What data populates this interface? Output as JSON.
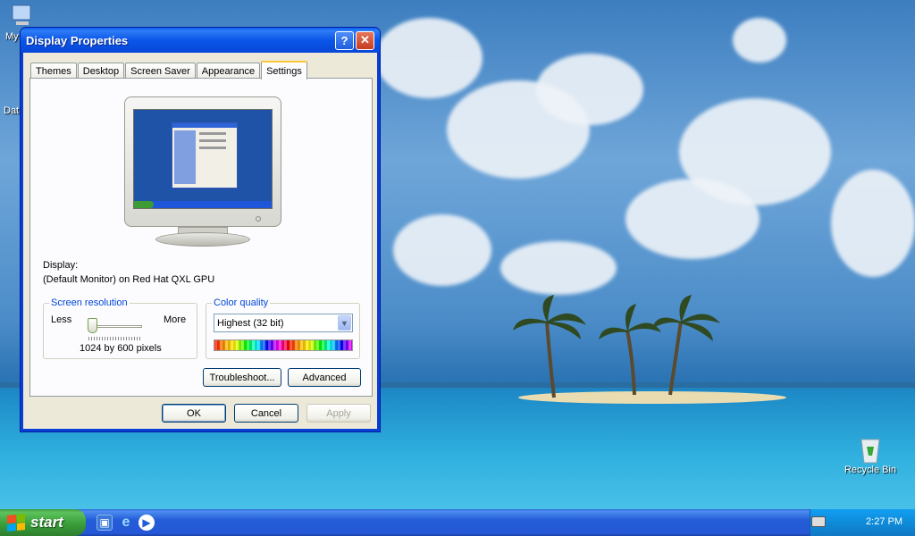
{
  "desktop": {
    "icons": [
      {
        "label": "My"
      },
      {
        "label": "Dat"
      },
      {
        "label": "Recycle Bin"
      }
    ]
  },
  "dialog": {
    "title": "Display Properties",
    "help_button": "?",
    "close_button": "✕",
    "tabs": [
      {
        "label": "Themes"
      },
      {
        "label": "Desktop"
      },
      {
        "label": "Screen Saver"
      },
      {
        "label": "Appearance"
      },
      {
        "label": "Settings",
        "active": true
      }
    ],
    "display_label": "Display:",
    "display_value": "(Default Monitor) on Red Hat QXL GPU",
    "screen_resolution": {
      "legend": "Screen resolution",
      "less_label": "Less",
      "more_label": "More",
      "value_text": "1024 by 600 pixels",
      "slider_level": 0.0
    },
    "color_quality": {
      "legend": "Color quality",
      "selected": "Highest (32 bit)"
    },
    "buttons": {
      "troubleshoot": "Troubleshoot...",
      "advanced": "Advanced",
      "ok": "OK",
      "cancel": "Cancel",
      "apply": "Apply"
    }
  },
  "taskbar": {
    "start_label": "start",
    "clock": "2:27 PM"
  },
  "colors": {
    "title_bar": "#0a56e8",
    "dialog_face": "#ece9d8",
    "taskbar": "#245dd7",
    "start_green": "#3a9e3a",
    "group_legend": "#0046d5"
  }
}
